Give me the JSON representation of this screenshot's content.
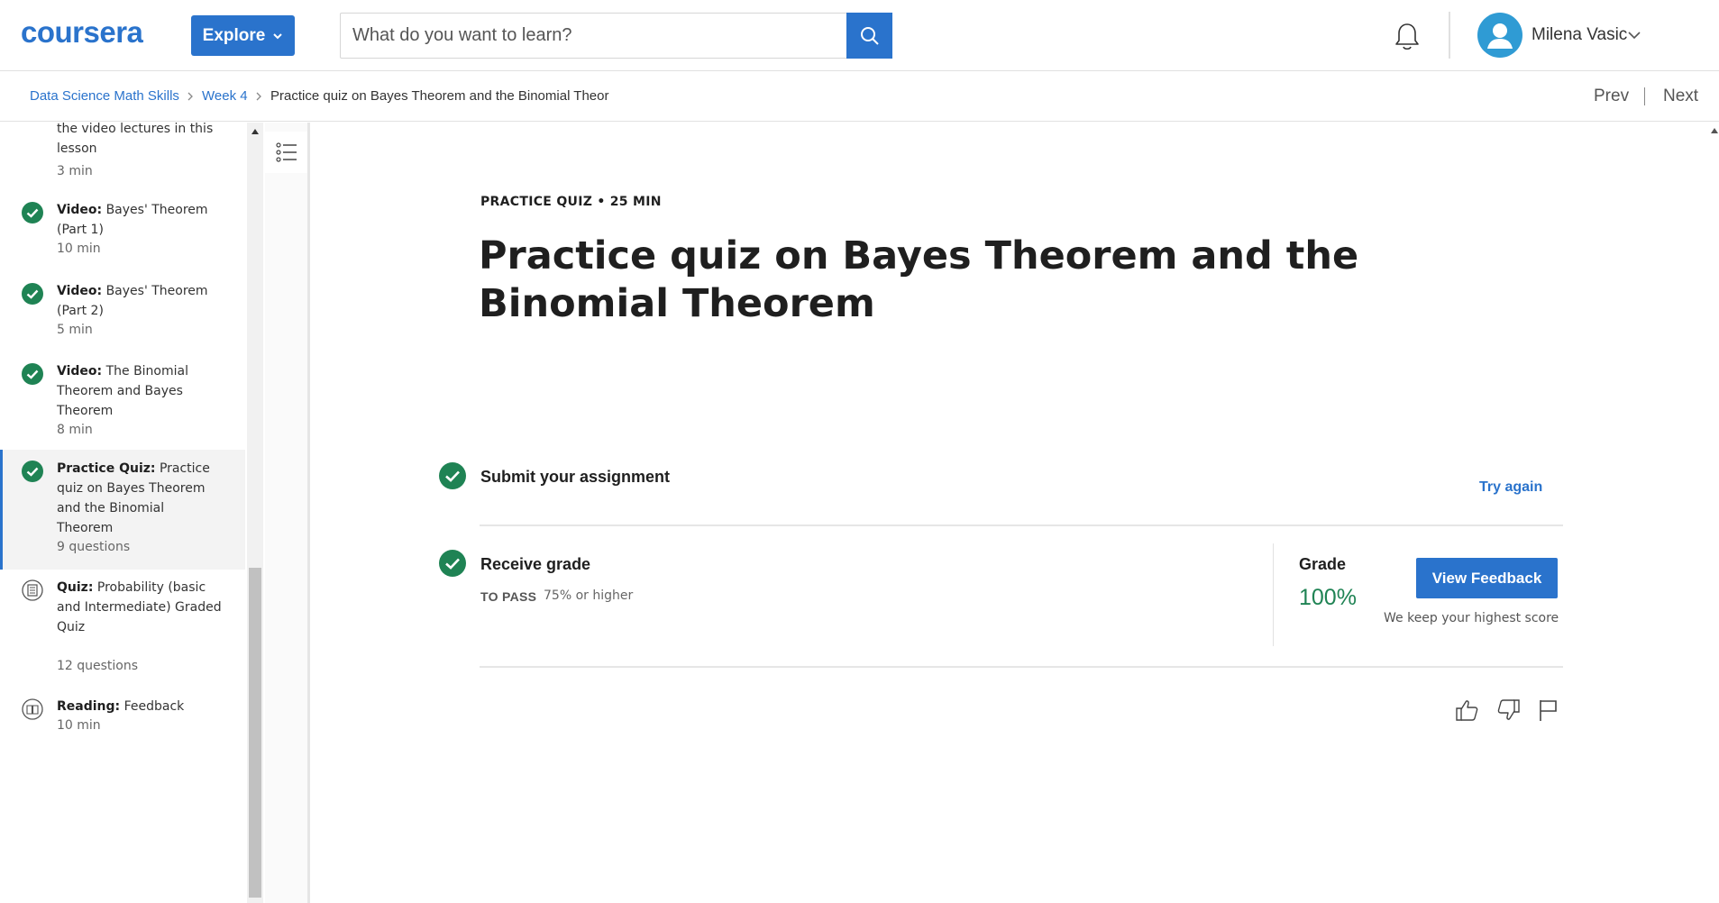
{
  "header": {
    "logo_text": "coursera",
    "explore_label": "Explore",
    "search_placeholder": "What do you want to learn?",
    "user_name": "Milena Vasic"
  },
  "breadcrumb": {
    "items": [
      "Data Science Math Skills",
      "Week 4",
      "Practice quiz on Bayes Theorem and the Binomial Theor"
    ],
    "prev_label": "Prev",
    "next_label": "Next"
  },
  "sidebar": {
    "items": [
      {
        "type": "",
        "title": "the video lectures in this lesson",
        "meta": "3 min",
        "status": "partial"
      },
      {
        "type": "Video:",
        "title": "Bayes' Theorem (Part 1)",
        "meta": "10 min",
        "status": "completed"
      },
      {
        "type": "Video:",
        "title": "Bayes' Theorem (Part 2)",
        "meta": "5 min",
        "status": "completed"
      },
      {
        "type": "Video:",
        "title": "The Binomial Theorem and Bayes Theorem",
        "meta": "8 min",
        "status": "completed"
      },
      {
        "type": "Practice Quiz:",
        "title": "Practice quiz on Bayes Theorem and the Binomial Theorem",
        "meta": "9 questions",
        "status": "completed"
      },
      {
        "type": "Quiz:",
        "title": "Probability (basic and Intermediate) Graded Quiz",
        "meta": "12 questions",
        "status": "quiz-icon"
      },
      {
        "type": "Reading:",
        "title": "Feedback",
        "meta": "10 min",
        "status": "reading-icon"
      }
    ]
  },
  "main": {
    "eyebrow": "PRACTICE QUIZ • 25 MIN",
    "title": "Practice quiz on Bayes Theorem and the Binomial Theorem",
    "submit_label": "Submit your assignment",
    "try_again_label": "Try again",
    "receive_grade_label": "Receive grade",
    "to_pass_label": "TO PASS",
    "to_pass_value": "75% or higher",
    "grade_label": "Grade",
    "grade_value": "100%",
    "view_feedback_label": "View Feedback",
    "keep_note": "We keep your highest score"
  },
  "colors": {
    "accent_blue": "#2a73cc",
    "success_green": "#1f8354",
    "avatar_blue": "#2f9bd4"
  }
}
